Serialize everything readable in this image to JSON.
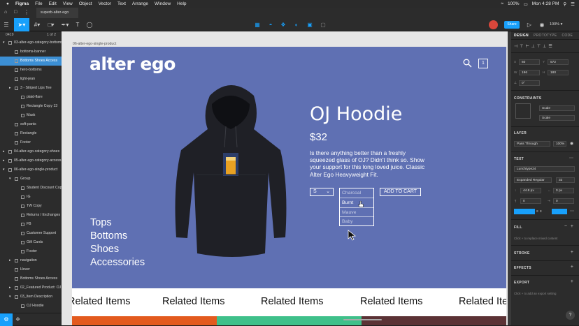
{
  "menubar": {
    "app": "Figma",
    "items": [
      "File",
      "Edit",
      "View",
      "Object",
      "Vector",
      "Text",
      "Arrange",
      "Window",
      "Help"
    ],
    "battery": "100%",
    "clock": "Mon 4:28 PM"
  },
  "tabbar": {
    "tab_title": "superb-alter-ego"
  },
  "toolbar": {
    "share_label": "Share",
    "zoom": "100%"
  },
  "layers_panel": {
    "page": "0419",
    "page_count": "1 of 2",
    "layers": [
      {
        "label": "03-alter-ego-category-bottoms",
        "indent": 0,
        "expand": "▾"
      },
      {
        "label": "bottoms-banner",
        "indent": 1,
        "expand": ""
      },
      {
        "label": "Bottoms Shoes Access",
        "indent": 1,
        "expand": "",
        "selected": true
      },
      {
        "label": "hero-bottoms",
        "indent": 1,
        "expand": ""
      },
      {
        "label": "light-jean",
        "indent": 1,
        "expand": ""
      },
      {
        "label": "3 - Striped Lips Tee",
        "indent": 1,
        "expand": "▸"
      },
      {
        "label": "plaid-flare",
        "indent": 2,
        "expand": ""
      },
      {
        "label": "Rectangle Copy 13",
        "indent": 2,
        "expand": ""
      },
      {
        "label": "Mask",
        "indent": 2,
        "expand": ""
      },
      {
        "label": "soft-pants",
        "indent": 1,
        "expand": ""
      },
      {
        "label": "Rectangle",
        "indent": 1,
        "expand": ""
      },
      {
        "label": "Footer",
        "indent": 1,
        "expand": ""
      },
      {
        "label": "04-alter-ego-category-shoes",
        "indent": 0,
        "expand": "▸"
      },
      {
        "label": "05-alter-ego-category-access...",
        "indent": 0,
        "expand": "▸"
      },
      {
        "label": "06-alter-ego-single-product",
        "indent": 0,
        "expand": "▾"
      },
      {
        "label": "Group",
        "indent": 1,
        "expand": "▾"
      },
      {
        "label": "Student Discount Copy",
        "indent": 2,
        "expand": ""
      },
      {
        "label": "IG",
        "indent": 2,
        "expand": ""
      },
      {
        "label": "TW Copy",
        "indent": 2,
        "expand": ""
      },
      {
        "label": "Returns / Exchanges",
        "indent": 2,
        "expand": ""
      },
      {
        "label": "FB",
        "indent": 2,
        "expand": ""
      },
      {
        "label": "Customer Support",
        "indent": 2,
        "expand": ""
      },
      {
        "label": "Gift Cards",
        "indent": 2,
        "expand": ""
      },
      {
        "label": "Footer",
        "indent": 2,
        "expand": ""
      },
      {
        "label": "navigation",
        "indent": 1,
        "expand": "▸"
      },
      {
        "label": "Hover",
        "indent": 1,
        "expand": ""
      },
      {
        "label": "Bottoms Shoes Access",
        "indent": 1,
        "expand": ""
      },
      {
        "label": "02_Featured Product: OJ ...",
        "indent": 1,
        "expand": "▸"
      },
      {
        "label": "03_Item Description",
        "indent": 1,
        "expand": "▾"
      },
      {
        "label": "OJ Hoodie",
        "indent": 2,
        "expand": ""
      }
    ]
  },
  "canvas": {
    "frame_label": "06-alter-ego-single-product",
    "logo": "alter ego",
    "cart_count": "1",
    "nav": [
      "Tops",
      "Bottoms",
      "Shoes",
      "Accessories"
    ],
    "product_title": "OJ Hoodie",
    "price": "$32",
    "description": "Is there anything better than a freshly squeezed glass of OJ? Didn't think so. Show your support for this long loved juice. Classic Alter Ego Heavyweight Fit.",
    "size_value": "S",
    "color_options": [
      "Charcoal",
      "Burnt",
      "Mauve",
      "Baby"
    ],
    "add_to_cart": "ADD TO CART",
    "related_label": "Related Items",
    "related_colors": [
      "#e35a1e",
      "#3fc08a",
      "#5b3235"
    ]
  },
  "design_panel": {
    "tabs": [
      "DESIGN",
      "PROTOTYPE",
      "CODE"
    ],
    "x": "60",
    "y": "572",
    "w": "196",
    "h": "180",
    "rotation": "0°",
    "constraints_label": "CONSTRAINTS",
    "constraint_h": "Scale",
    "constraint_v": "Scale",
    "layer_label": "LAYER",
    "blend": "Pass Through",
    "opacity": "100%",
    "text_label": "TEXT",
    "font_family": "Lunchtype24",
    "font_style": "Expanded Regular",
    "font_size": "32",
    "line_height": "44.8 px",
    "letter_spacing": "0 px",
    "para_spacing": "0",
    "para_indent": "0",
    "fill_label": "FILL",
    "fill_hint": "Click + to replace mixed content",
    "stroke_label": "STROKE",
    "effects_label": "EFFECTS",
    "export_label": "EXPORT",
    "export_hint": "Click + to add an export setting",
    "help": "?"
  }
}
